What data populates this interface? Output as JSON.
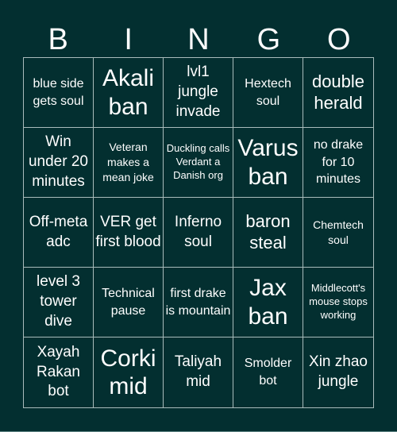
{
  "header": {
    "letters": [
      "B",
      "I",
      "N",
      "G",
      "O"
    ]
  },
  "board": {
    "colors": {
      "background": "#032f30",
      "grid_line": "#a9bcbb",
      "text": "#ffffff"
    },
    "cells": [
      "blue side gets soul",
      "Akali ban",
      "lvl1 jungle invade",
      "Hextech soul",
      "double herald",
      "Win under 20 minutes",
      "Veteran makes a mean joke",
      "Duckling calls Verdant a Danish org",
      "Varus ban",
      "no drake for 10 minutes",
      "Off-meta adc",
      "VER get first blood",
      "Inferno soul",
      "baron steal",
      "Chemtech soul",
      "level 3 tower dive",
      "Technical pause",
      "first drake is mountain",
      "Jax ban",
      "Middlecott's mouse stops working",
      "Xayah Rakan bot",
      "Corki mid",
      "Taliyah mid",
      "Smolder bot",
      "Xin zhao jungle"
    ]
  }
}
